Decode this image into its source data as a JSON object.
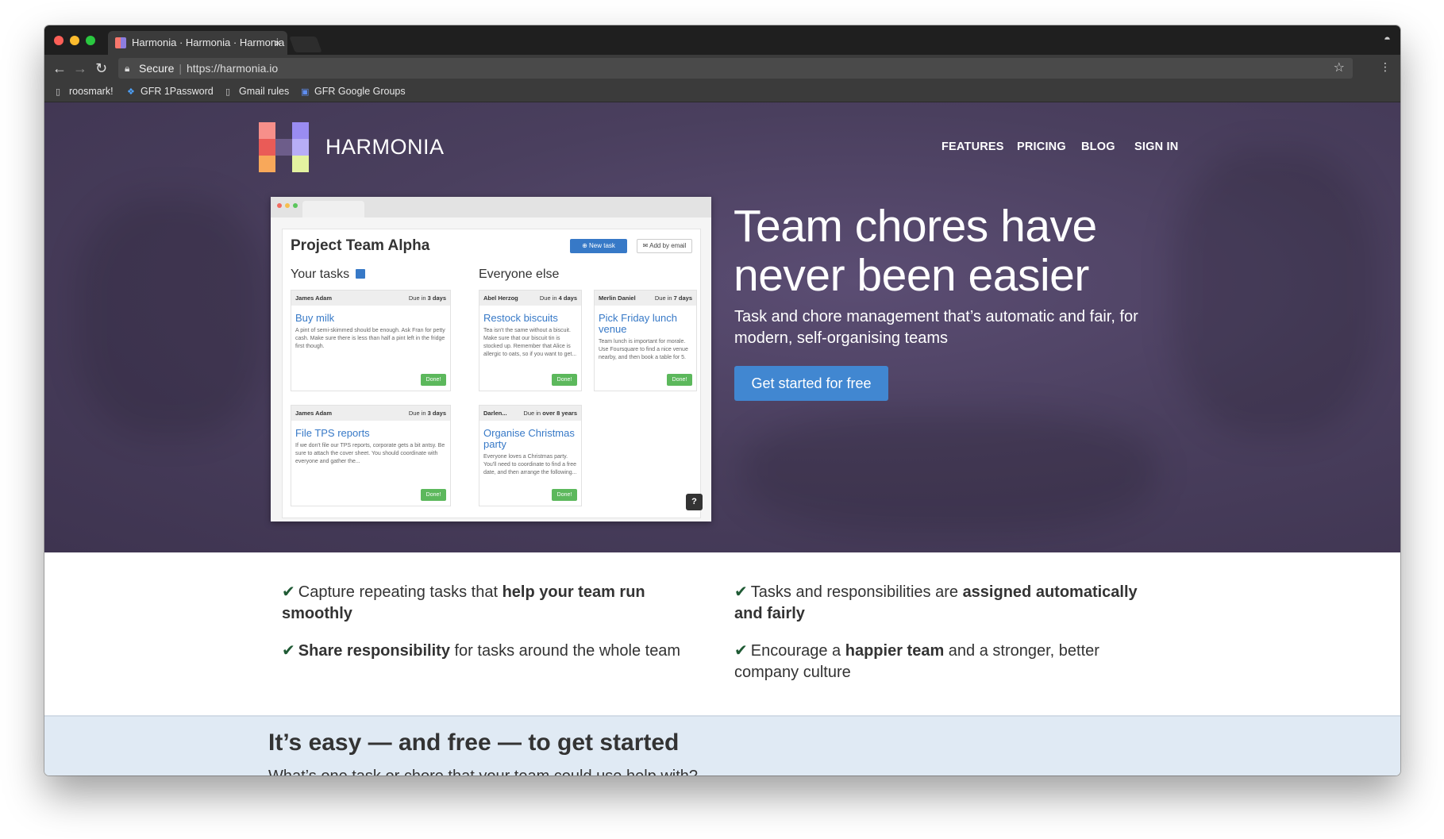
{
  "browser": {
    "tab_title": "Harmonia · Harmonia · Harmonia",
    "tab_close": "×",
    "secure_label": "Secure",
    "url": "https://harmonia.io",
    "bookmarks": [
      {
        "label": "roosmark!"
      },
      {
        "label": "GFR 1Password"
      },
      {
        "label": "Gmail rules"
      },
      {
        "label": "GFR Google Groups"
      }
    ]
  },
  "site": {
    "brand": "HARMONIA",
    "nav": [
      "FEATURES",
      "PRICING",
      "BLOG",
      "SIGN IN"
    ],
    "logo_colors": [
      "#f78f8a",
      "#ea5b57",
      "#f8a85a",
      "#6d5d8a",
      "#9a8cf2",
      "#b7adf6",
      "#e3f2a0"
    ],
    "headline": "Team chores have never been easier",
    "subheadline": "Task and chore management that’s automatic and fair, for modern, self-organising teams",
    "cta": "Get started for free"
  },
  "preview": {
    "title": "Project Team Alpha",
    "new_task": "⊕ New task",
    "add_by_email": "✉ Add by email",
    "your_tasks": "Your tasks",
    "everyone_else": "Everyone else",
    "done_label": "Done!",
    "help": "?",
    "cards": [
      {
        "who": "James Adam",
        "due_prefix": "Due in",
        "due": "3 days",
        "title": "Buy milk",
        "desc": "A pint of semi-skimmed should be enough. Ask Fran for petty cash. Make sure there is less than half a pint left in the fridge first though."
      },
      {
        "who": "Abel Herzog",
        "due_prefix": "Due in",
        "due": "4 days",
        "title": "Restock biscuits",
        "desc": "Tea isn't the same without a biscuit. Make sure that our biscuit tin is stocked up. Remember that Alice is allergic to oats, so if you want to get..."
      },
      {
        "who": "Merlin Daniel",
        "due_prefix": "Due in",
        "due": "7 days",
        "title": "Pick Friday lunch venue",
        "desc": "Team lunch is important for morale. Use Foursquare to find a nice venue nearby, and then book a table for 5."
      },
      {
        "who": "James Adam",
        "due_prefix": "Due in",
        "due": "3 days",
        "title": "File TPS reports",
        "desc": "If we don't file our TPS reports, corporate gets a bit antsy. Be sure to attach the cover sheet. You should coordinate with everyone and gather the..."
      },
      {
        "who": "Darlen...",
        "due_prefix": "Due in",
        "due": "over 8 years",
        "title": "Organise Christmas party",
        "desc": "Everyone loves a Christmas party. You'll need to coordinate to find a free date, and then arrange the following..."
      }
    ]
  },
  "features": [
    {
      "pre": "Capture repeating tasks that ",
      "bold": "help your team run smoothly",
      "post": ""
    },
    {
      "pre": "Tasks and responsibilities are ",
      "bold": "assigned automatically and fairly",
      "post": ""
    },
    {
      "pre": "",
      "bold": "Share responsibility",
      "post": " for tasks around the whole team"
    },
    {
      "pre": "Encourage a ",
      "bold": "happier team",
      "post": " and a stronger, better company culture"
    }
  ],
  "check": "✔",
  "easy": {
    "title": "It’s easy — and free — to get started",
    "subtitle": "What’s one task or chore that your team could use help with?"
  }
}
